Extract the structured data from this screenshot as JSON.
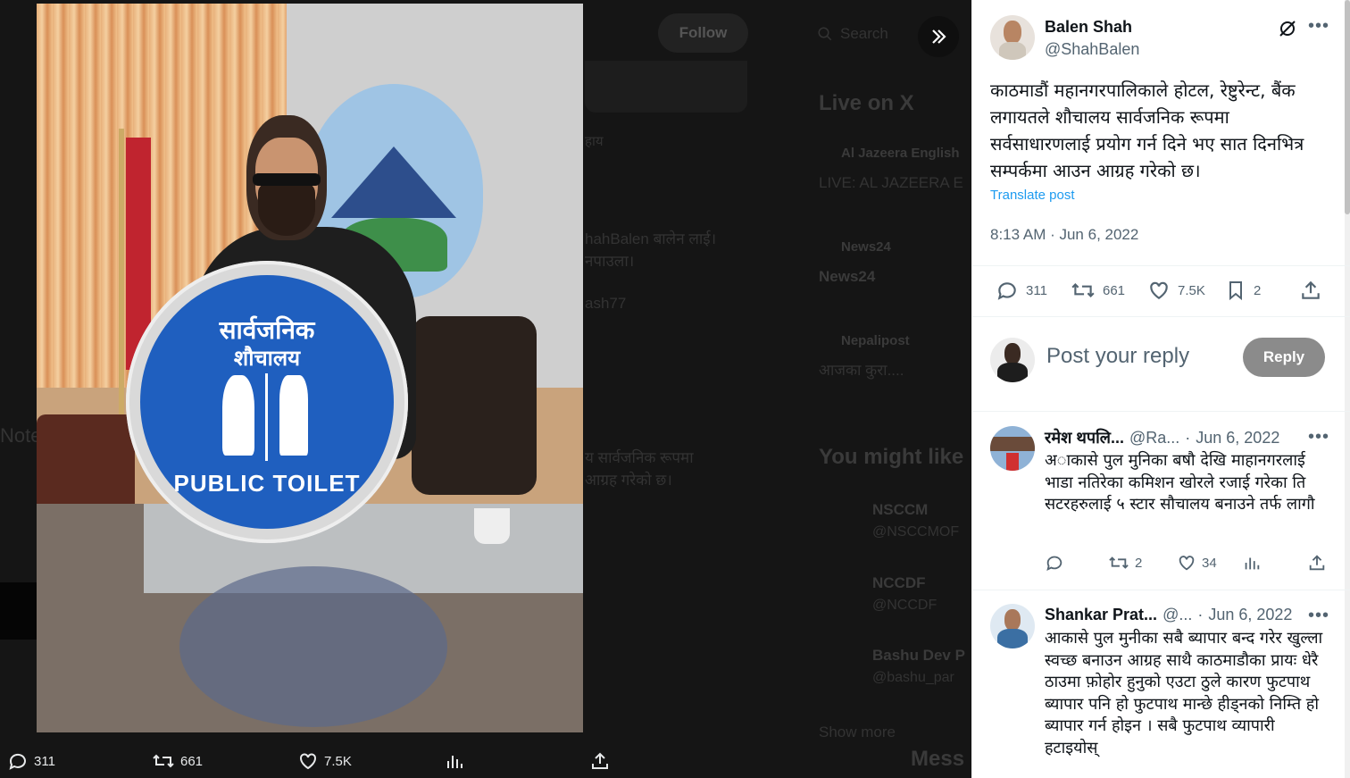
{
  "media": {
    "follow_label": "Follow",
    "search_placeholder": "Search",
    "actions": {
      "replies": "311",
      "reposts": "661",
      "likes": "7.5K"
    },
    "sign": {
      "title": "सार्वजनिक",
      "subtitle": "शौचालय",
      "bottom": "PUBLIC TOILET"
    },
    "background": {
      "live_heading": "Live on X",
      "live_items": [
        {
          "source": "Al Jazeera English",
          "title": "LIVE: AL JAZEERA E"
        },
        {
          "source": "News24",
          "title": "News24"
        },
        {
          "source": "Nepalipost",
          "title": "आजका कुरा...."
        }
      ],
      "you_might_like": "You might like",
      "suggestions": [
        {
          "name": "NSCCM",
          "handle": "@NSCCMOF"
        },
        {
          "name": "NCCDF",
          "handle": "@NCCDF"
        },
        {
          "name": "Bashu Dev P",
          "handle": "@bashu_par"
        }
      ],
      "show_more": "Show more",
      "messages": "Mess",
      "fragments": [
        "हाय",
        "hahBalen बालेन लाई।",
        "नपाउला।",
        "ash77",
        "य सार्वजनिक रूपमा",
        "आग्रह गरेको छ।",
        "Note"
      ]
    }
  },
  "tweet": {
    "author_name": "Balen Shah",
    "author_handle": "@ShahBalen",
    "text": "काठमाडौं महानगरपालिकाले होटल, रेष्टुरेन्ट, बैंक लगायतले शौचालय सार्वजनिक रूपमा सर्वसाधारणलाई प्रयोग गर्न दिने भए सात दिनभित्र सम्पर्कमा आउन आग्रह गरेको छ।",
    "translate_label": "Translate post",
    "timestamp": "8:13 AM · Jun 6, 2022",
    "stats": {
      "replies": "311",
      "reposts": "661",
      "likes": "7.5K",
      "bookmarks": "2"
    }
  },
  "compose": {
    "placeholder": "Post your reply",
    "button_label": "Reply"
  },
  "replies": [
    {
      "name": "रमेश थपलि...",
      "handle": "@Ra...",
      "date": "Jun 6, 2022",
      "text": "अाकासे पुल मुनिका बषौ देखि माहानगरलाई भाडा नतिरेका कमिशन खोरले रजाई गरेका ति सटरहरुलाई ५ स्टार सौचालय बनाउने तर्फ लागौ",
      "reposts": "2",
      "likes": "34"
    },
    {
      "name": "Shankar Prat...",
      "handle": "@...",
      "date": "Jun 6, 2022",
      "text": "आकासे पुल मुनीका सबै ब्यापार बन्द गरेर खुल्ला स्वच्छ बनाउन आग्रह साथै काठमाडौका प्रायः धेरै ठाउमा फ़ोहोर हुनुको एउटा ठुले कारण फुटपाथ ब्यापार पनि हो फुटपाथ मान्छे हीड्नको निम्ति हो ब्यापार गर्न होइन । सबै फुटपाथ व्यापारी हटाइयोस्",
      "reposts": "",
      "likes": ""
    }
  ]
}
